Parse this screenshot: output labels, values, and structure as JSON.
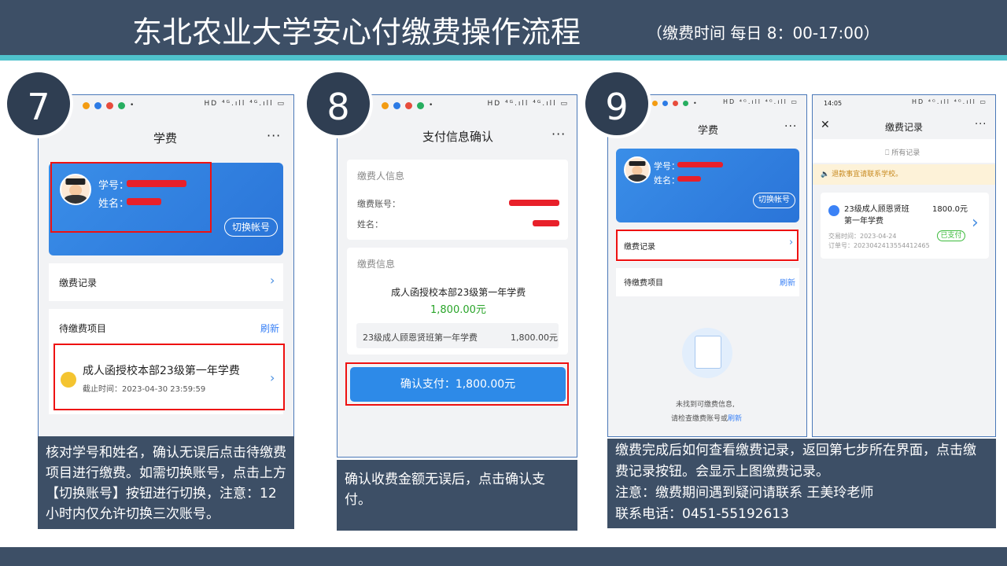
{
  "header": {
    "title": "东北农业大学安心付缴费操作流程",
    "subtitle": "（缴费时间 每日 8：00-17:00）"
  },
  "steps": [
    {
      "number": "7",
      "caption": "核对学号和姓名，确认无误后点击待缴费项目进行缴费。如需切换账号，点击上方【切换账号】按钮进行切换，注意：12小时内仅允许切换三次账号。"
    },
    {
      "number": "8",
      "caption": "确认收费金额无误后，点击确认支付。"
    },
    {
      "number": "9",
      "caption_lines": [
        "缴费完成后如何查看缴费记录，返回第七步所在界面，点击缴费记录按钮。会显示上图缴费记录。",
        "注意：缴费期间遇到疑问请联系 王美玲老师",
        "联系电话：0451-55192613"
      ]
    }
  ],
  "phone1": {
    "title": "学费",
    "more": "···",
    "student_id_label": "学号：",
    "name_label": "姓名：",
    "switch_account": "切换帐号",
    "payment_records": "缴费记录",
    "pending_items": "待缴费项目",
    "refresh": "刷新",
    "item_title": "成人函授校本部23级第一年学费",
    "deadline": "截止时间：2023-04-30 23:59:59"
  },
  "phone2": {
    "title": "支付信息确认",
    "more": "···",
    "payer_info": "缴费人信息",
    "account_label": "缴费账号：",
    "name_label": "姓名：",
    "payment_info": "缴费信息",
    "item_title": "成人函授校本部23级第一年学费",
    "amount": "1,800.00元",
    "line_item": "23级成人顾恩贤班第一年学费",
    "line_amount": "1,800.00元",
    "confirm_btn": "确认支付：1,800.00元"
  },
  "phone3": {
    "title": "学费",
    "more": "···",
    "student_id_label": "学号：",
    "name_label": "姓名：",
    "switch_account": "切换帐号",
    "payment_records": "缴费记录",
    "pending_items": "待缴费项目",
    "refresh": "刷新",
    "empty1": "未找到可缴费信息,",
    "empty2": "请检查缴费账号或",
    "empty2_link": "刷新"
  },
  "phone4": {
    "time": "14:05",
    "title": "缴费记录",
    "more": "···",
    "all_records": "所有记录",
    "notice": "退款事宜请联系学校。",
    "record_title": "23级成人顾恩贤班",
    "record_title2": "第一年学费",
    "record_amount": "1800.0元",
    "trade_time": "交易时间：2023-04-24",
    "order_no": "订单号：2023042413554412465",
    "status": "已支付"
  }
}
